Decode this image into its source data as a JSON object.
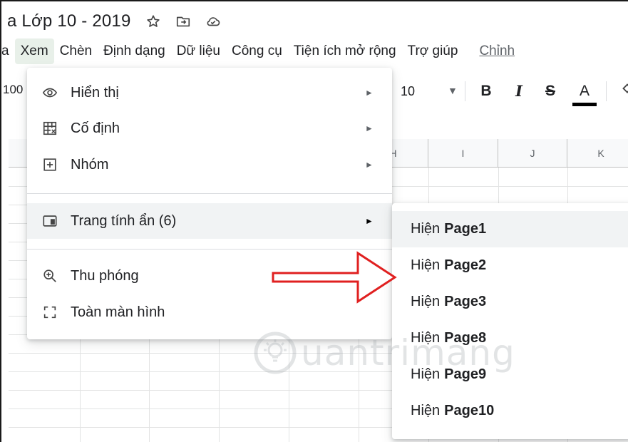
{
  "app": {
    "doc_title": "a Lớp 10 - 2019"
  },
  "menu_bar": {
    "items": [
      "a",
      "Xem",
      "Chèn",
      "Định dạng",
      "Dữ liệu",
      "Công cụ",
      "Tiện ích mở rộng",
      "Trợ giúp"
    ],
    "last_edit_link": "Chỉnh"
  },
  "toolbar": {
    "zoom_partial": "100",
    "font_size": "10",
    "bold_label": "B",
    "italic_label": "I",
    "strike_label": "S",
    "text_color_label": "A",
    "text_color": "#000000"
  },
  "sheet": {
    "column_headers": [
      "H",
      "I",
      "J",
      "K"
    ]
  },
  "view_menu": {
    "items": [
      {
        "label": "Hiển thị",
        "icon": "eye-icon",
        "has_submenu": true
      },
      {
        "label": "Cố định",
        "icon": "freeze-grid-icon",
        "has_submenu": true
      },
      {
        "label": "Nhóm",
        "icon": "group-plus-icon",
        "has_submenu": true
      },
      {
        "label": "Trang tính ẩn (6)",
        "icon": "hidden-sheet-icon",
        "has_submenu": true
      },
      {
        "label": "Thu phóng",
        "icon": "zoom-in-icon",
        "has_submenu": true
      },
      {
        "label": "Toàn màn hình",
        "icon": "fullscreen-icon",
        "has_submenu": false
      }
    ]
  },
  "hidden_sheets_submenu": {
    "prefix": "Hiện",
    "sheets": [
      "Page1",
      "Page2",
      "Page3",
      "Page8",
      "Page9",
      "Page10"
    ]
  },
  "annotation": {
    "arrow_color": "#e02020"
  },
  "watermark": {
    "text": "uantrimang"
  },
  "colors": {
    "menu_active_bg": "#e8f0e9",
    "hover_bg": "#f1f3f4",
    "separator": "#dadce0"
  }
}
